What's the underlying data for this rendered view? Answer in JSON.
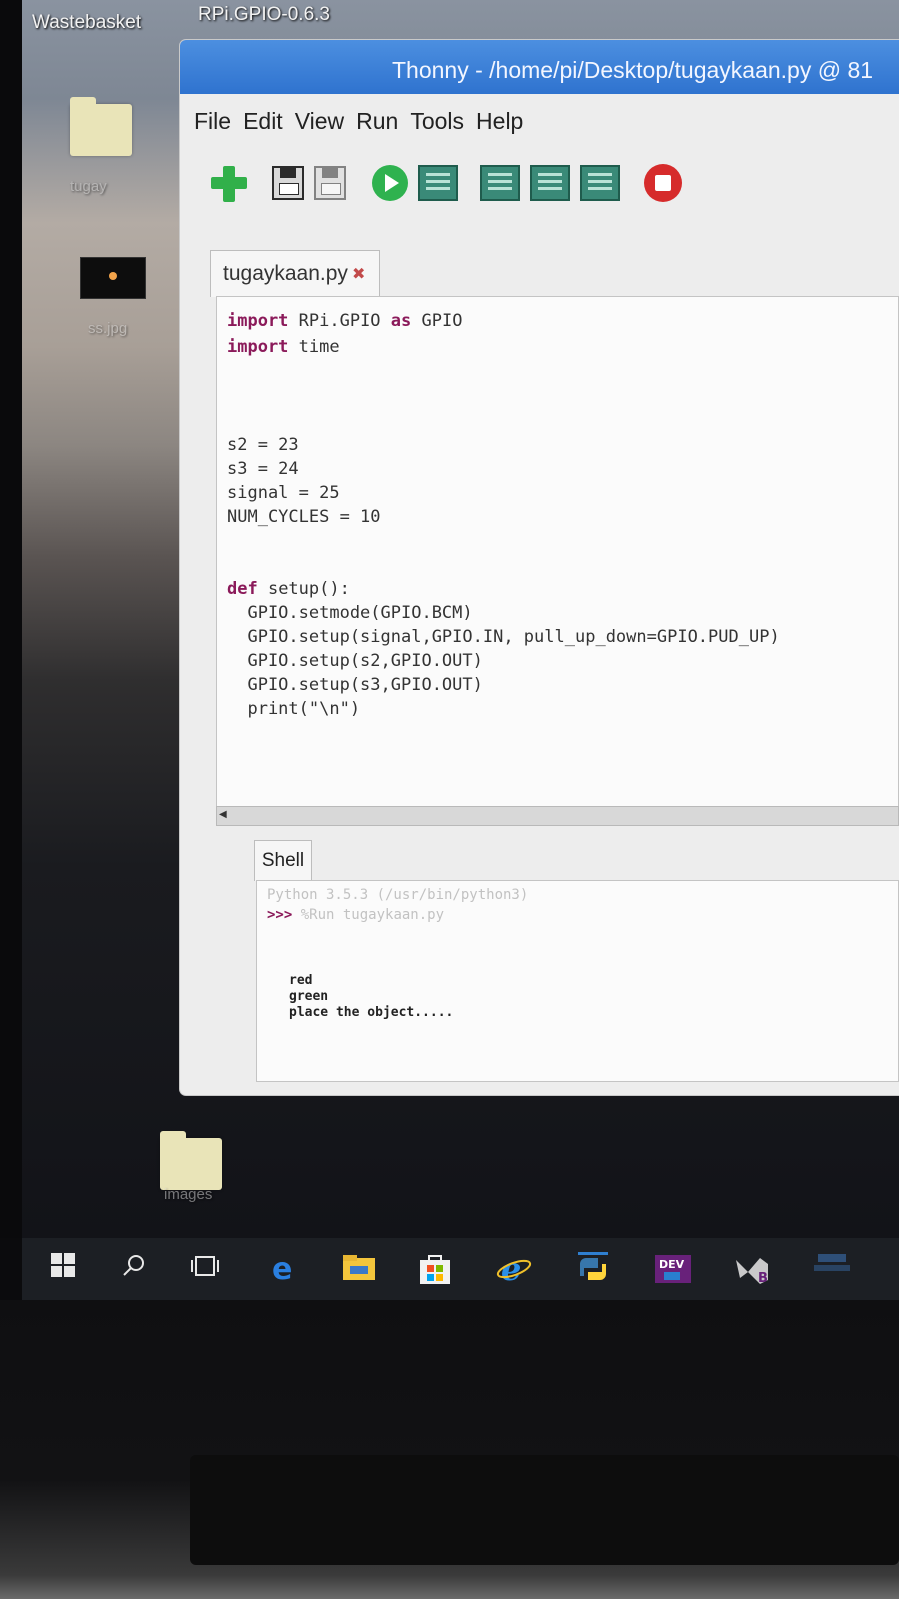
{
  "desktop": {
    "top_labels": {
      "wastebasket": "Wastebasket",
      "gpio": "RPi.GPIO-0.6.3"
    },
    "icons": {
      "folder1_label": "tugay",
      "jpg_label": "ss.jpg",
      "images_label": "images"
    }
  },
  "window": {
    "title": "Thonny  -  /home/pi/Desktop/tugaykaan.py  @  81",
    "menu": [
      "File",
      "Edit",
      "View",
      "Run",
      "Tools",
      "Help"
    ],
    "toolbar_icons": [
      "new-file-icon",
      "open-file-icon",
      "save-file-icon",
      "run-icon",
      "debug-icon",
      "step-over-icon",
      "step-into-icon",
      "step-out-icon",
      "stop-icon"
    ]
  },
  "editor": {
    "tab_label": "tugaykaan.py",
    "lines": {
      "l1_kw": "import",
      "l1_rest": " RPi.GPIO ",
      "l1_kw2": "as",
      "l1_rest2": " GPIO",
      "l2_kw": "import",
      "l2_rest": " time",
      "l3": "s2 = 23",
      "l4": "s3 = 24",
      "l5": "signal = 25",
      "l6": "NUM_CYCLES = 10",
      "l7_kw": "def",
      "l7_rest": " setup():",
      "l8": "  GPIO.setmode(GPIO.BCM)",
      "l9": "  GPIO.setup(signal,GPIO.IN, pull_up_down=GPIO.PUD_UP)",
      "l10": "  GPIO.setup(s2,GPIO.OUT)",
      "l11": "  GPIO.setup(s3,GPIO.OUT)",
      "l12": "  print(\"\\n\")"
    }
  },
  "shell": {
    "tab_label": "Shell",
    "version": "Python 3.5.3 (/usr/bin/python3)",
    "prompt": ">>>",
    "command": " %Run tugaykaan.py",
    "output": [
      "red",
      "green",
      "place the object....."
    ]
  },
  "taskbar": {
    "icons": [
      "windows-start-icon",
      "search-icon",
      "task-view-icon",
      "edge-icon",
      "file-explorer-icon",
      "store-icon",
      "internet-explorer-icon",
      "python-icon",
      "dev-icon",
      "visual-studio-blend-icon",
      "feedback-icon"
    ],
    "dev_label": "DEV",
    "blend_label": "B"
  }
}
